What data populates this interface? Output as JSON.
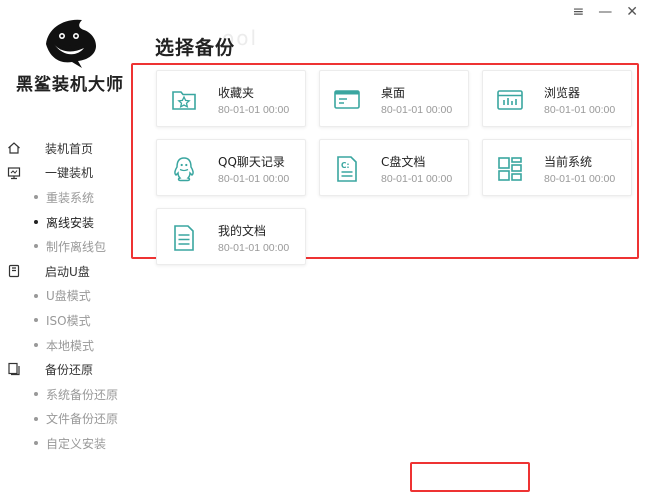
{
  "app": {
    "logo_text": "黑鲨装机大师",
    "watermark": "ool"
  },
  "window_controls": {
    "menu": "≡",
    "minimize": "—",
    "close": "✕"
  },
  "sidebar": {
    "groups": [
      {
        "label": "装机首页",
        "icon": "home-icon",
        "items": []
      },
      {
        "label": "一键装机",
        "icon": "monitor-icon",
        "items": [
          "重装系统",
          "离线安装",
          "制作离线包"
        ]
      },
      {
        "label": "启动U盘",
        "icon": "usb-drive-icon",
        "items": [
          "U盘模式",
          "ISO模式",
          "本地模式"
        ]
      },
      {
        "label": "备份还原",
        "icon": "backup-icon",
        "items": [
          "系统备份还原",
          "文件备份还原",
          "自定义安装"
        ]
      }
    ],
    "active_item": "离线安装"
  },
  "main": {
    "title": "选择备份",
    "cards": [
      {
        "name": "收藏夹",
        "date": "80-01-01 00:00",
        "icon": "favorites-folder-icon"
      },
      {
        "name": "桌面",
        "date": "80-01-01 00:00",
        "icon": "desktop-icon"
      },
      {
        "name": "浏览器",
        "date": "80-01-01 00:00",
        "icon": "browser-icon"
      },
      {
        "name": "QQ聊天记录",
        "date": "80-01-01 00:00",
        "icon": "qq-penguin-icon"
      },
      {
        "name": "C盘文档",
        "date": "80-01-01 00:00",
        "icon": "c-drive-document-icon"
      },
      {
        "name": "当前系统",
        "date": "80-01-01 00:00",
        "icon": "current-system-icon"
      },
      {
        "name": "我的文档",
        "date": "80-01-01 00:00",
        "icon": "document-icon"
      }
    ]
  },
  "colors": {
    "accent_teal": "#3aa6a0",
    "highlight_red": "#e33333",
    "active_bg": "#ececec"
  }
}
